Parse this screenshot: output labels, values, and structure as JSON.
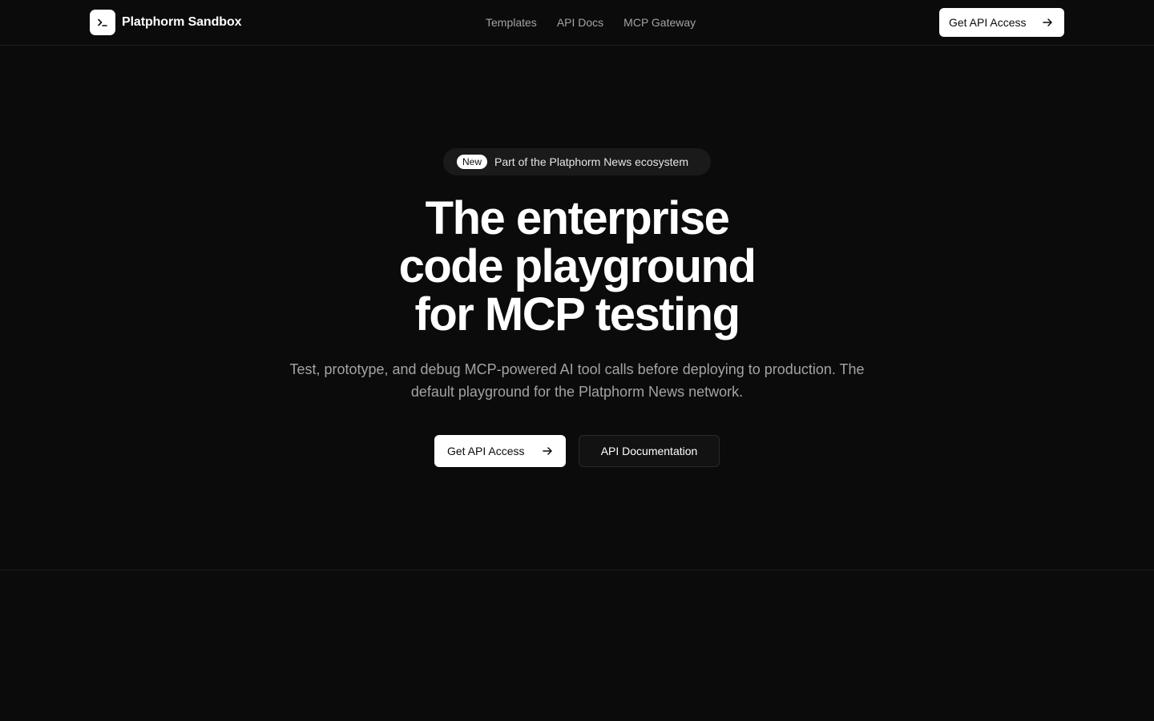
{
  "header": {
    "brand_name": "Platphorm Sandbox",
    "brand_icon": "terminal-icon",
    "nav": [
      {
        "label": "Templates"
      },
      {
        "label": "API Docs"
      },
      {
        "label": "MCP Gateway"
      }
    ],
    "cta_label": "Get API Access",
    "cta_icon": "arrow-right-icon"
  },
  "hero": {
    "badge": "New",
    "announcement": "Part of the Platphorm News ecosystem",
    "headline_lines": [
      "The enterprise",
      "code playground",
      "for MCP testing"
    ],
    "subtext": "Test, prototype, and debug MCP-powered AI tool calls before deploying to production. The default playground for the Platphorm News network.",
    "primary_cta": "Get API Access",
    "secondary_cta": "API Documentation"
  },
  "colors": {
    "background": "#0b0b0b",
    "text_primary": "#ffffff",
    "text_muted": "#a3a3a3",
    "button_primary_bg": "#ffffff",
    "pill_bg": "#1a1a1a"
  }
}
